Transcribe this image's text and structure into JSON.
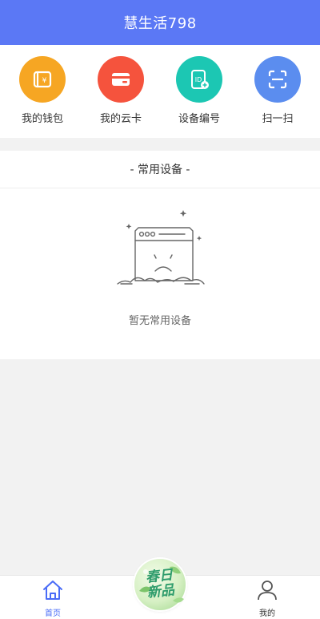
{
  "header": {
    "title": "慧生活798"
  },
  "quick_actions": [
    {
      "label": "我的钱包",
      "icon": "wallet-icon",
      "color": "#f6a623"
    },
    {
      "label": "我的云卡",
      "icon": "card-icon",
      "color": "#f5533d"
    },
    {
      "label": "设备编号",
      "icon": "device-id-icon",
      "color": "#1cc7b3"
    },
    {
      "label": "扫一扫",
      "icon": "scan-icon",
      "color": "#5b8def"
    }
  ],
  "common_devices": {
    "title": "- 常用设备 -",
    "empty_text": "暂无常用设备"
  },
  "promo": {
    "line1": "春日",
    "line2": "新品"
  },
  "tabbar": {
    "home": {
      "label": "首页",
      "color": "#4a6cf7"
    },
    "mine": {
      "label": "我的",
      "color": "#333333"
    }
  },
  "colors": {
    "header_bg": "#5b78f5",
    "page_bg": "#f2f2f2"
  }
}
